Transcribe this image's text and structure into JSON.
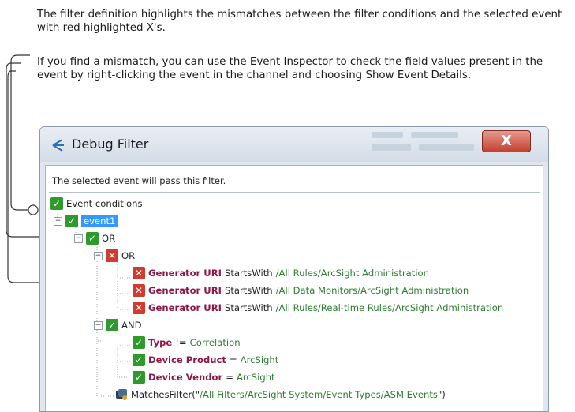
{
  "captions": {
    "filter_definition": "The filter definition highlights the mismatches between the filter conditions and the selected event with red highlighted X's.",
    "mismatch": "If you find a mismatch, you can use the Event Inspector to check the field values present in the event by right-clicking the event in the channel and choosing Show Event Details."
  },
  "window": {
    "title": "Debug Filter",
    "close_glyph": "X",
    "status": "The selected event will pass this filter."
  },
  "tree": {
    "root": "Event conditions",
    "event": "event1",
    "or_outer": "OR",
    "or_inner": "OR",
    "or_conditions": [
      {
        "field": "Generator URI",
        "op": "StartsWith",
        "value": "/All Rules/ArcSight Administration",
        "status": "fail"
      },
      {
        "field": "Generator URI",
        "op": "StartsWith",
        "value": "/All Data Monitors/ArcSight Administration",
        "status": "fail"
      },
      {
        "field": "Generator URI",
        "op": "StartsWith",
        "value": "/All Rules/Real-time Rules/ArcSight Administration",
        "status": "fail"
      }
    ],
    "and": "AND",
    "and_conditions": [
      {
        "field": "Type",
        "op": "!=",
        "value": "Correlation",
        "status": "pass"
      },
      {
        "field": "Device Product",
        "op": "=",
        "value": "ArcSight",
        "status": "pass"
      },
      {
        "field": "Device Vendor",
        "op": "=",
        "value": "ArcSight",
        "status": "pass"
      }
    ],
    "matches": {
      "prefix": "MatchesFilter(\"",
      "path": "/All Filters/ArcSight System/Event Types/ASM Events",
      "suffix": "\")"
    }
  },
  "icons": {
    "pass": "check-icon",
    "fail": "x-icon",
    "debug": "debug-filter-icon",
    "filter": "filter-icon"
  },
  "colors": {
    "pass": "#2e9a2c",
    "fail": "#d13a2d",
    "selection": "#3399ff",
    "field": "#8b1a4a",
    "value": "#2e7d32",
    "close": "#c4402f"
  }
}
